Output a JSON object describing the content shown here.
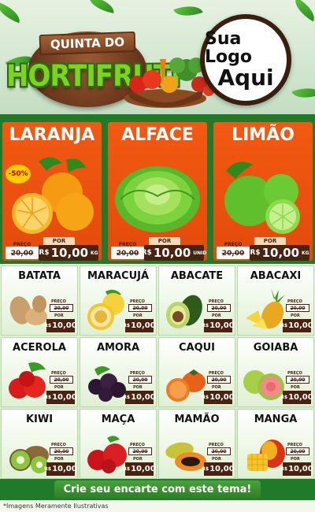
{
  "header": {
    "logo_top": "QUINTA DO",
    "logo_main": "HORTIFRUTI",
    "brand_line1": "Sua Logo",
    "brand_line2": "Aqui"
  },
  "featured": [
    {
      "name": "LARANJA",
      "badge": "-50%",
      "preco_label": "PREÇO",
      "old_price": "20,00",
      "por_label": "POR",
      "currency": "R$",
      "price": "10,00",
      "unit": "KG",
      "icon": "orange-icon"
    },
    {
      "name": "ALFACE",
      "preco_label": "PREÇO",
      "old_price": "20,00",
      "por_label": "POR",
      "currency": "R$",
      "price": "10,00",
      "unit": "UNID",
      "icon": "lettuce-icon"
    },
    {
      "name": "LIMÃO",
      "preco_label": "PREÇO",
      "old_price": "20,00",
      "por_label": "POR",
      "currency": "R$",
      "price": "10,00",
      "unit": "KG",
      "icon": "lime-icon"
    }
  ],
  "products": [
    {
      "name": "BATATA",
      "preco_label": "PREÇO",
      "old_price": "20,00",
      "por_label": "POR",
      "currency": "R$",
      "price": "10,00",
      "icon": "potato-icon"
    },
    {
      "name": "MARACUJÁ",
      "preco_label": "PREÇO",
      "old_price": "20,00",
      "por_label": "POR",
      "currency": "R$",
      "price": "10,00",
      "icon": "passionfruit-icon"
    },
    {
      "name": "ABACATE",
      "preco_label": "PREÇO",
      "old_price": "20,00",
      "por_label": "POR",
      "currency": "R$",
      "price": "10,00",
      "icon": "avocado-icon"
    },
    {
      "name": "ABACAXI",
      "preco_label": "PREÇO",
      "old_price": "20,00",
      "por_label": "POR",
      "currency": "R$",
      "price": "10,00",
      "icon": "pineapple-icon"
    },
    {
      "name": "ACEROLA",
      "preco_label": "PREÇO",
      "old_price": "20,00",
      "por_label": "POR",
      "currency": "R$",
      "price": "10,00",
      "icon": "acerola-icon"
    },
    {
      "name": "AMORA",
      "preco_label": "PREÇO",
      "old_price": "20,00",
      "por_label": "POR",
      "currency": "R$",
      "price": "10,00",
      "icon": "blackberry-icon"
    },
    {
      "name": "CAQUI",
      "preco_label": "PREÇO",
      "old_price": "20,00",
      "por_label": "POR",
      "currency": "R$",
      "price": "10,00",
      "icon": "persimmon-icon"
    },
    {
      "name": "GOIABA",
      "preco_label": "PREÇO",
      "old_price": "20,00",
      "por_label": "POR",
      "currency": "R$",
      "price": "10,00",
      "icon": "guava-icon"
    },
    {
      "name": "KIWI",
      "preco_label": "PREÇO",
      "old_price": "20,00",
      "por_label": "POR",
      "currency": "R$",
      "price": "10,00",
      "icon": "kiwi-icon"
    },
    {
      "name": "MAÇA",
      "preco_label": "PREÇO",
      "old_price": "20,00",
      "por_label": "POR",
      "currency": "R$",
      "price": "10,00",
      "icon": "apple-icon"
    },
    {
      "name": "MAMÃO",
      "preco_label": "PREÇO",
      "old_price": "20,00",
      "por_label": "POR",
      "currency": "R$",
      "price": "10,00",
      "icon": "papaya-icon"
    },
    {
      "name": "MANGA",
      "preco_label": "PREÇO",
      "old_price": "20,00",
      "por_label": "POR",
      "currency": "R$",
      "price": "10,00",
      "icon": "mango-icon"
    }
  ],
  "cta": {
    "label": "Crie seu encarte com este tema!"
  },
  "footnote": "*Imagens Meramente Ilustrativas",
  "colors": {
    "featured_bg": "#f25a12",
    "price_box": "#4a2210",
    "brand_green": "#1f7a2a"
  }
}
